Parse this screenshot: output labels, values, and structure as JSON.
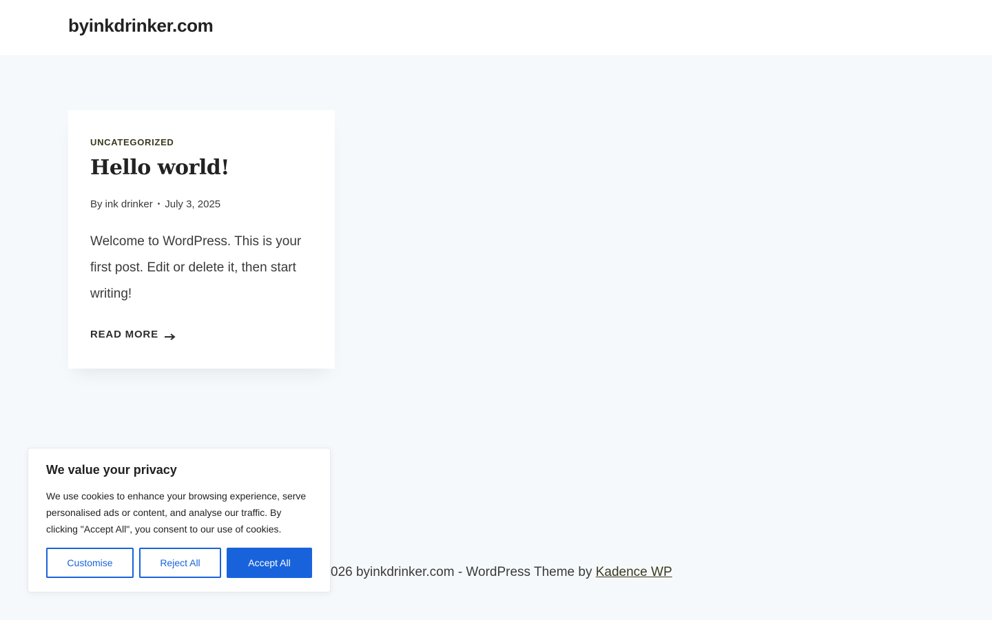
{
  "header": {
    "site_title": "byinkdrinker.com"
  },
  "post": {
    "category": "UNCATEGORIZED",
    "title": "Hello world!",
    "meta_by": "By",
    "author": "ink drinker",
    "separator": "•",
    "date": "July 3, 2025",
    "excerpt": "Welcome to WordPress. This is your first post. Edit or delete it, then start writing!",
    "read_more": "READ MORE"
  },
  "footer": {
    "text_visible": "026 byinkdrinker.com - WordPress Theme by",
    "theme_link": "Kadence WP"
  },
  "cookie_banner": {
    "title": "We value your privacy",
    "text": "We use cookies to enhance your browsing experience, serve personalised ads or content, and analyse our traffic. By clicking \"Accept All\", you consent to our use of cookies.",
    "customise_label": "Customise",
    "reject_label": "Reject All",
    "accept_label": "Accept All",
    "accent_color": "#1863dc"
  },
  "icons": {
    "read_more_icon": "arrow-right-icon"
  }
}
